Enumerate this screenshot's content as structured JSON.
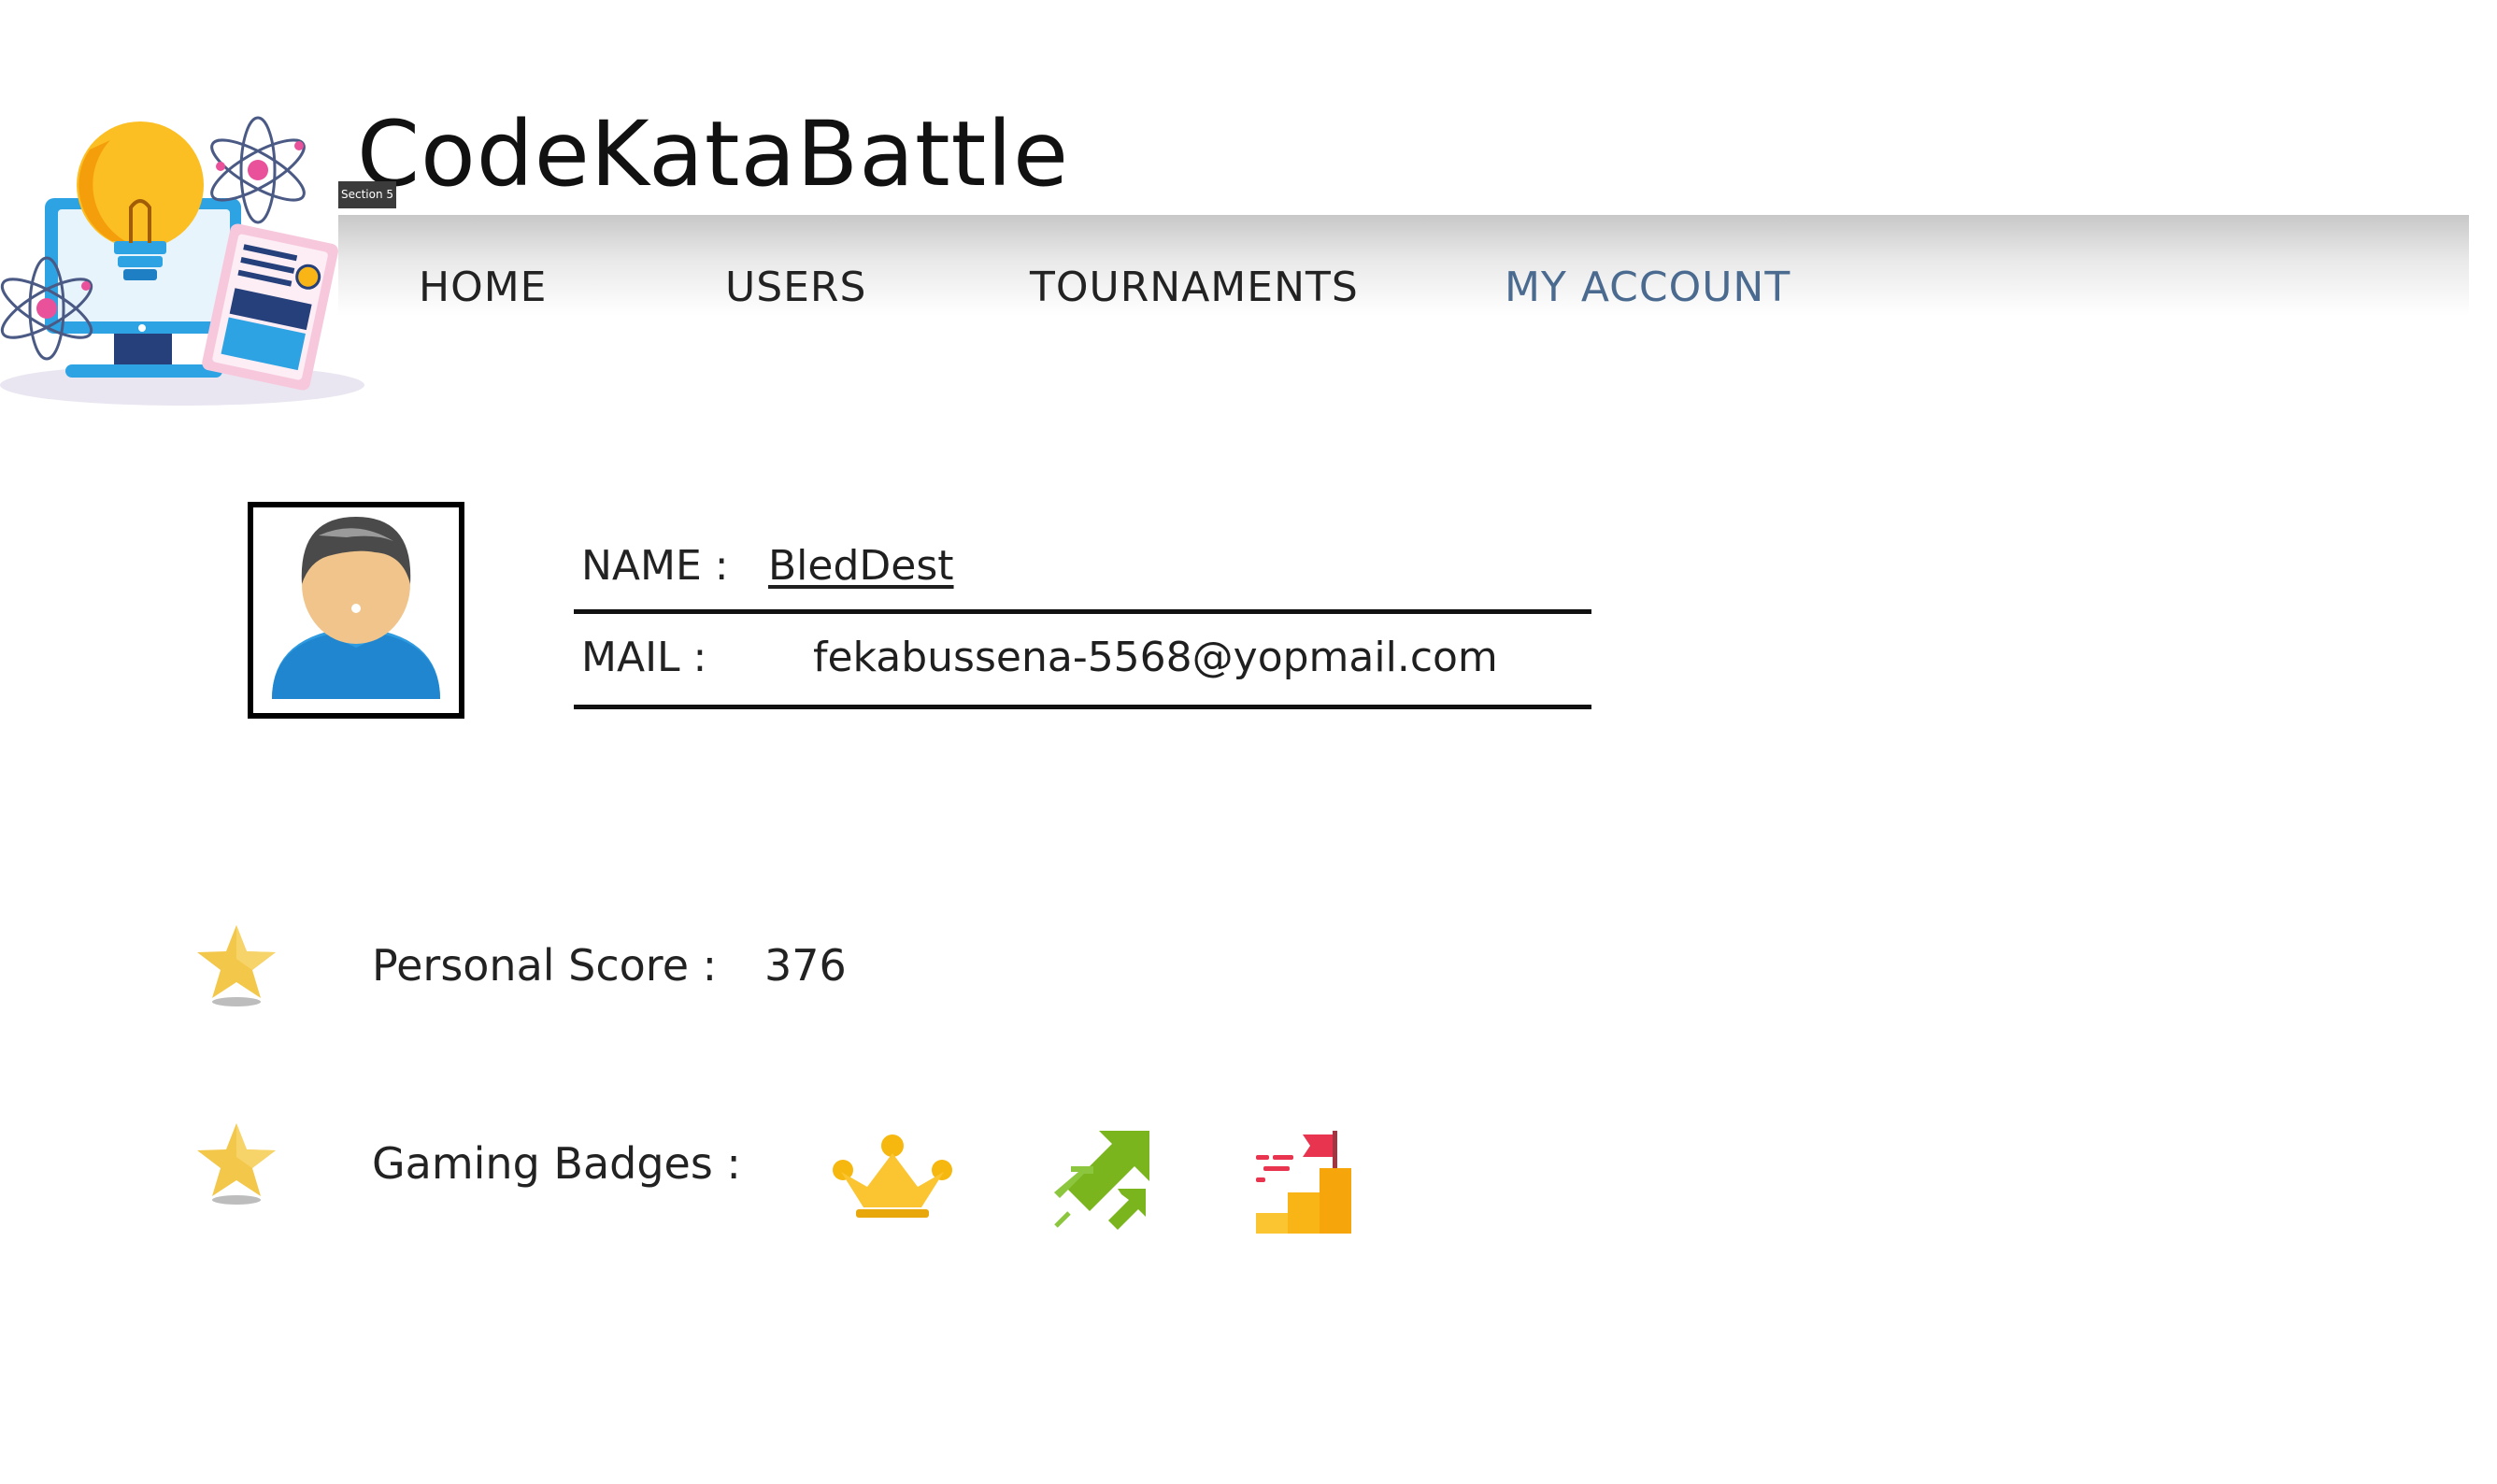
{
  "header": {
    "app_title": "CodeKataBattle",
    "section_tag": "Section 5"
  },
  "nav": {
    "items": [
      {
        "label": "HOME",
        "active": false
      },
      {
        "label": "USERS",
        "active": false
      },
      {
        "label": "TOURNAMENTS",
        "active": false
      },
      {
        "label": "MY ACCOUNT",
        "active": true
      }
    ],
    "active_color": "#4a6b8f"
  },
  "profile": {
    "name_label": "NAME :",
    "name_value": "BledDest",
    "mail_label": "MAIL :",
    "mail_value": "fekabussena-5568@yopmail.com"
  },
  "stats": {
    "score_label": "Personal Score :",
    "score_value": "376",
    "badges_label": "Gaming Badges :",
    "badges": [
      "crown-badge-icon",
      "growth-arrows-badge-icon",
      "goal-flag-badge-icon"
    ]
  },
  "colors": {
    "star": "#f3c74a",
    "crown": "#f6b80f",
    "arrows": "#7ab51d",
    "flag": "#e8344e",
    "steps": "#f8b515"
  }
}
